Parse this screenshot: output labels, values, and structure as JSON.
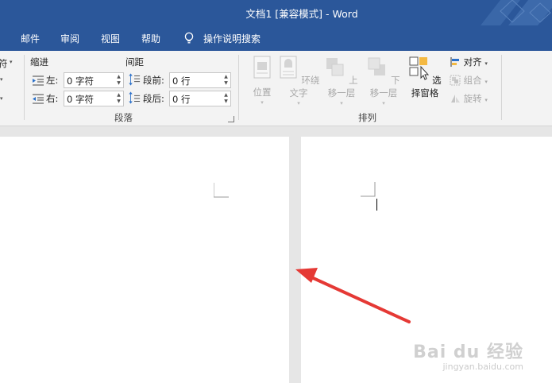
{
  "window": {
    "title": "文档1 [兼容模式]  -  Word"
  },
  "tabs": [
    "邮件",
    "审阅",
    "视图",
    "帮助"
  ],
  "tell_me": "操作说明搜索",
  "ribbon": {
    "cut_label": "符",
    "paragraph": {
      "indent_header": "缩进",
      "spacing_header": "间距",
      "left_label": "左:",
      "left_value": "0 字符",
      "right_label": "右:",
      "right_value": "0 字符",
      "before_label": "段前:",
      "before_value": "0 行",
      "after_label": "段后:",
      "after_value": "0 行",
      "group_label": "段落"
    },
    "arrange": {
      "position": "位置",
      "wrap_text": "环绕文字",
      "bring_forward": "上移一层",
      "send_backward": "下移一层",
      "selection_pane": "选择窗格",
      "align": "对齐",
      "group": "组合",
      "rotate": "旋转",
      "group_label": "排列"
    }
  },
  "annotation": {
    "arrow_color": "#e53935"
  },
  "watermark": {
    "brand": "Bai du 经验",
    "url": "jingyan.baidu.com"
  },
  "colors": {
    "titlebar": "#2b579a",
    "ribbon": "#f3f3f3",
    "canvas": "#e6e6e6"
  }
}
